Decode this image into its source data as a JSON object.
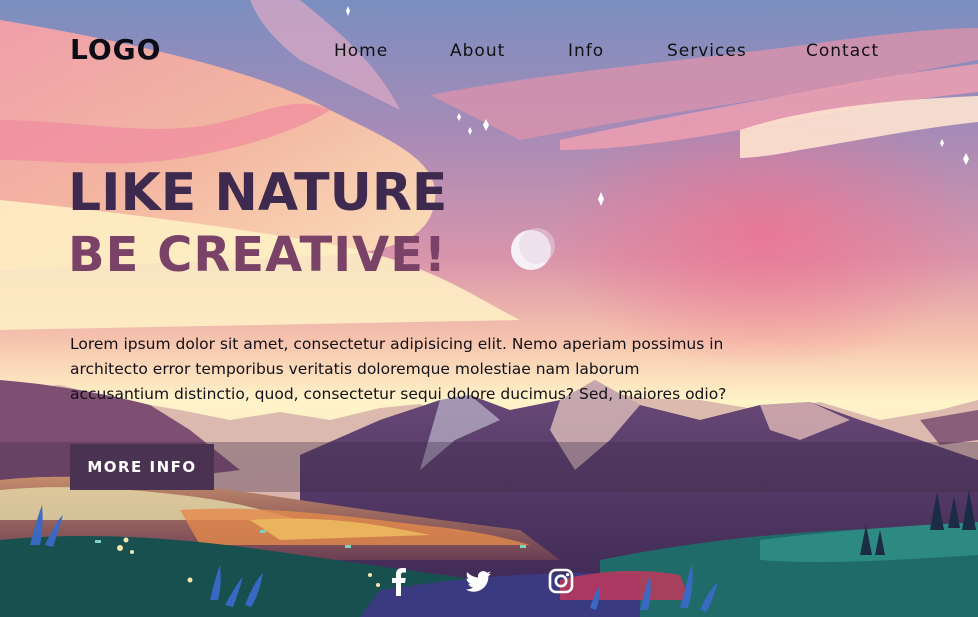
{
  "header": {
    "logo": "LOGO",
    "nav": [
      "Home",
      "About",
      "Info",
      "Services",
      "Contact"
    ]
  },
  "hero": {
    "title_line1": "LIKE NATURE",
    "title_line2": "BE CREATIVE!",
    "description": "Lorem ipsum dolor sit amet, consectetur adipisicing elit. Nemo aperiam possimus in architecto error temporibus veritatis doloremque molestiae nam laborum accusantium distinctio, quod, consectetur sequi dolore ducimus? Sed, maiores odio?",
    "cta_label": "MORE INFO"
  },
  "social": {
    "icons": [
      "facebook-icon",
      "twitter-icon",
      "instagram-icon"
    ]
  },
  "colors": {
    "title_dark": "#3e2a4e",
    "title_accent": "#7a4266",
    "button_bg": "#4a3252",
    "sky_top": "#6f86b8",
    "sky_pink": "#e6859a",
    "horizon_cream": "#fff4c4"
  }
}
